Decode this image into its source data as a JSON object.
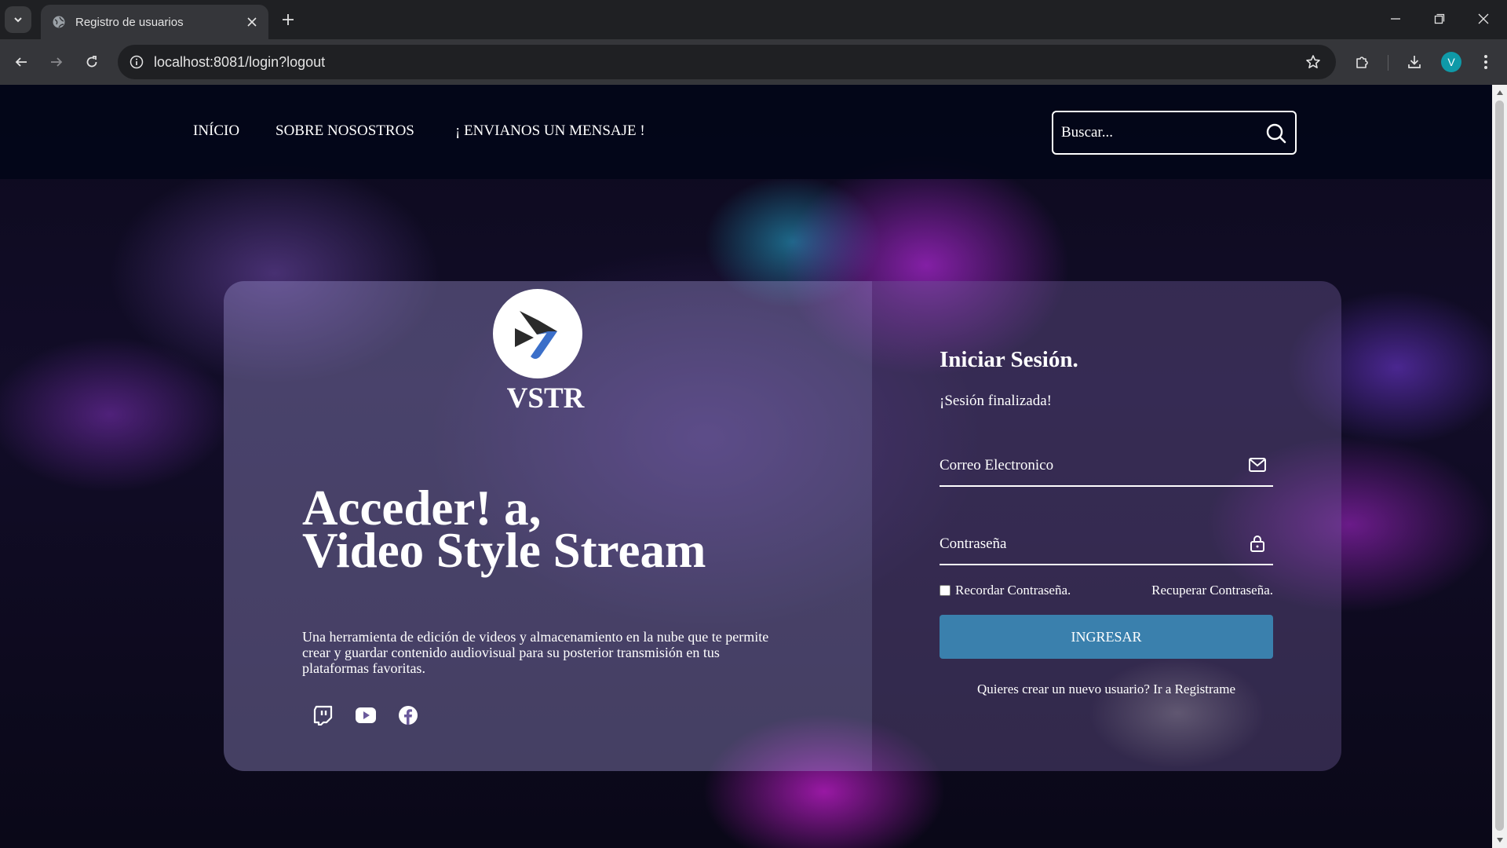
{
  "browser": {
    "tab_title": "Registro de usuarios",
    "url": "localhost:8081/login?logout",
    "profile_initial": "V"
  },
  "nav": {
    "items": [
      {
        "label": "INÍCIO"
      },
      {
        "label": "SOBRE NOSOSTROS"
      },
      {
        "label": "¡ ENVIANOS UN MENSAJE !"
      }
    ],
    "search_placeholder": "Buscar..."
  },
  "hero": {
    "brand": "VSTR",
    "title_line1": "Acceder! a,",
    "title_line2": "Video Style Stream",
    "description": "Una herramienta de edición de videos y almacenamiento en la nube que te permite crear y guardar contenido audiovisual para su posterior transmisión en tus plataformas favoritas.",
    "social_icons": [
      "twitch-icon",
      "youtube-icon",
      "facebook-icon"
    ]
  },
  "login": {
    "title": "Iniciar Sesión.",
    "message": "¡Sesión finalizada!",
    "email_placeholder": "Correo Electronico",
    "password_placeholder": "Contraseña",
    "remember_label": "Recordar Contraseña.",
    "forgot_label": "Recuperar Contraseña.",
    "submit_label": "INGRESAR",
    "register_text": "Quieres crear un nuevo usuario? Ir a Registrame"
  },
  "colors": {
    "button": "#3a80ad",
    "logo_dark": "#2b2b2b",
    "logo_blue": "#3b6fc9"
  }
}
